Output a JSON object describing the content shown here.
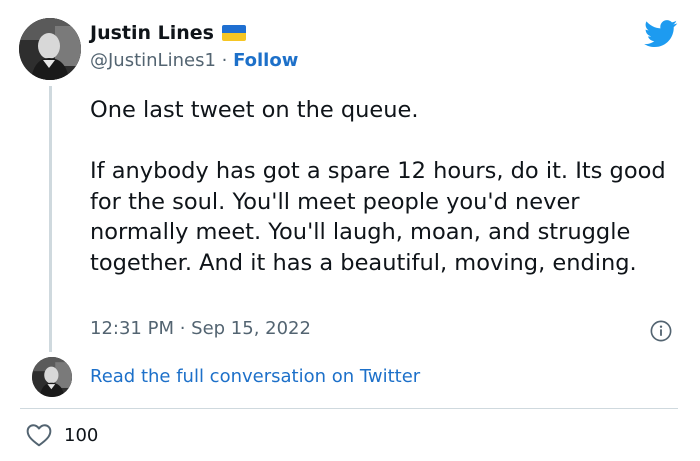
{
  "author": {
    "display_name": "Justin Lines",
    "handle": "@JustinLines1",
    "separator": " · ",
    "follow_label": "Follow",
    "flag": "ukraine-flag-icon"
  },
  "tweet": {
    "text": "One last tweet on the queue.\n\nIf anybody has got a spare 12 hours, do it. Its good for the soul. You'll meet people you'd never normally meet. You'll laugh, moan, and struggle together. And it has a beautiful, moving, ending.",
    "timestamp": "12:31 PM · Sep 15, 2022"
  },
  "footer": {
    "read_full_label": "Read the full conversation on Twitter",
    "like_count": "100"
  },
  "colors": {
    "link_blue": "#1d70c9",
    "twitter_blue": "#1d9bf0",
    "text_dark": "#0f1419",
    "text_gray": "#536471",
    "divider": "#cfd9de",
    "flag_blue": "#1f6fd1",
    "flag_yellow": "#f6c624"
  },
  "icons": {
    "brand": "twitter-bird-icon",
    "info": "info-icon",
    "like": "heart-icon"
  }
}
